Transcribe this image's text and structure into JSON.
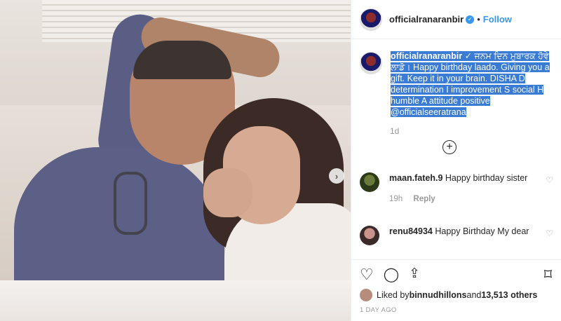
{
  "post": {
    "account": "officialranaranbir",
    "follow_label": "Follow",
    "separator": "•",
    "caption": {
      "username": "officialranaranbir",
      "text": "ਜਨਮ ਦਿਨ ਮੁਬਾਰਕ ਹੋਵੇ ਲਾਡੋ। Happy birthday laado. Giving you a gift. Keep it in your brain. DISHA D determination I improvement S social H humble A attitude positive @officialseeratrana"
    },
    "time_ago": "1d",
    "load_more_label": "+"
  },
  "comments": [
    {
      "username": "maan.fateh.9",
      "text": "Happy birthday sister",
      "age": "19h",
      "reply_label": "Reply"
    },
    {
      "username": "renu84934",
      "text": "Happy Birthday My dear",
      "age": "",
      "reply_label": ""
    }
  ],
  "likes": {
    "prefix": "Liked by ",
    "user": "binnudhillons",
    "middle": " and ",
    "count": "13,513 others"
  },
  "date_label": "1 DAY AGO",
  "colors": {
    "accent": "#3897f0",
    "selection": "#3a7bd5"
  }
}
